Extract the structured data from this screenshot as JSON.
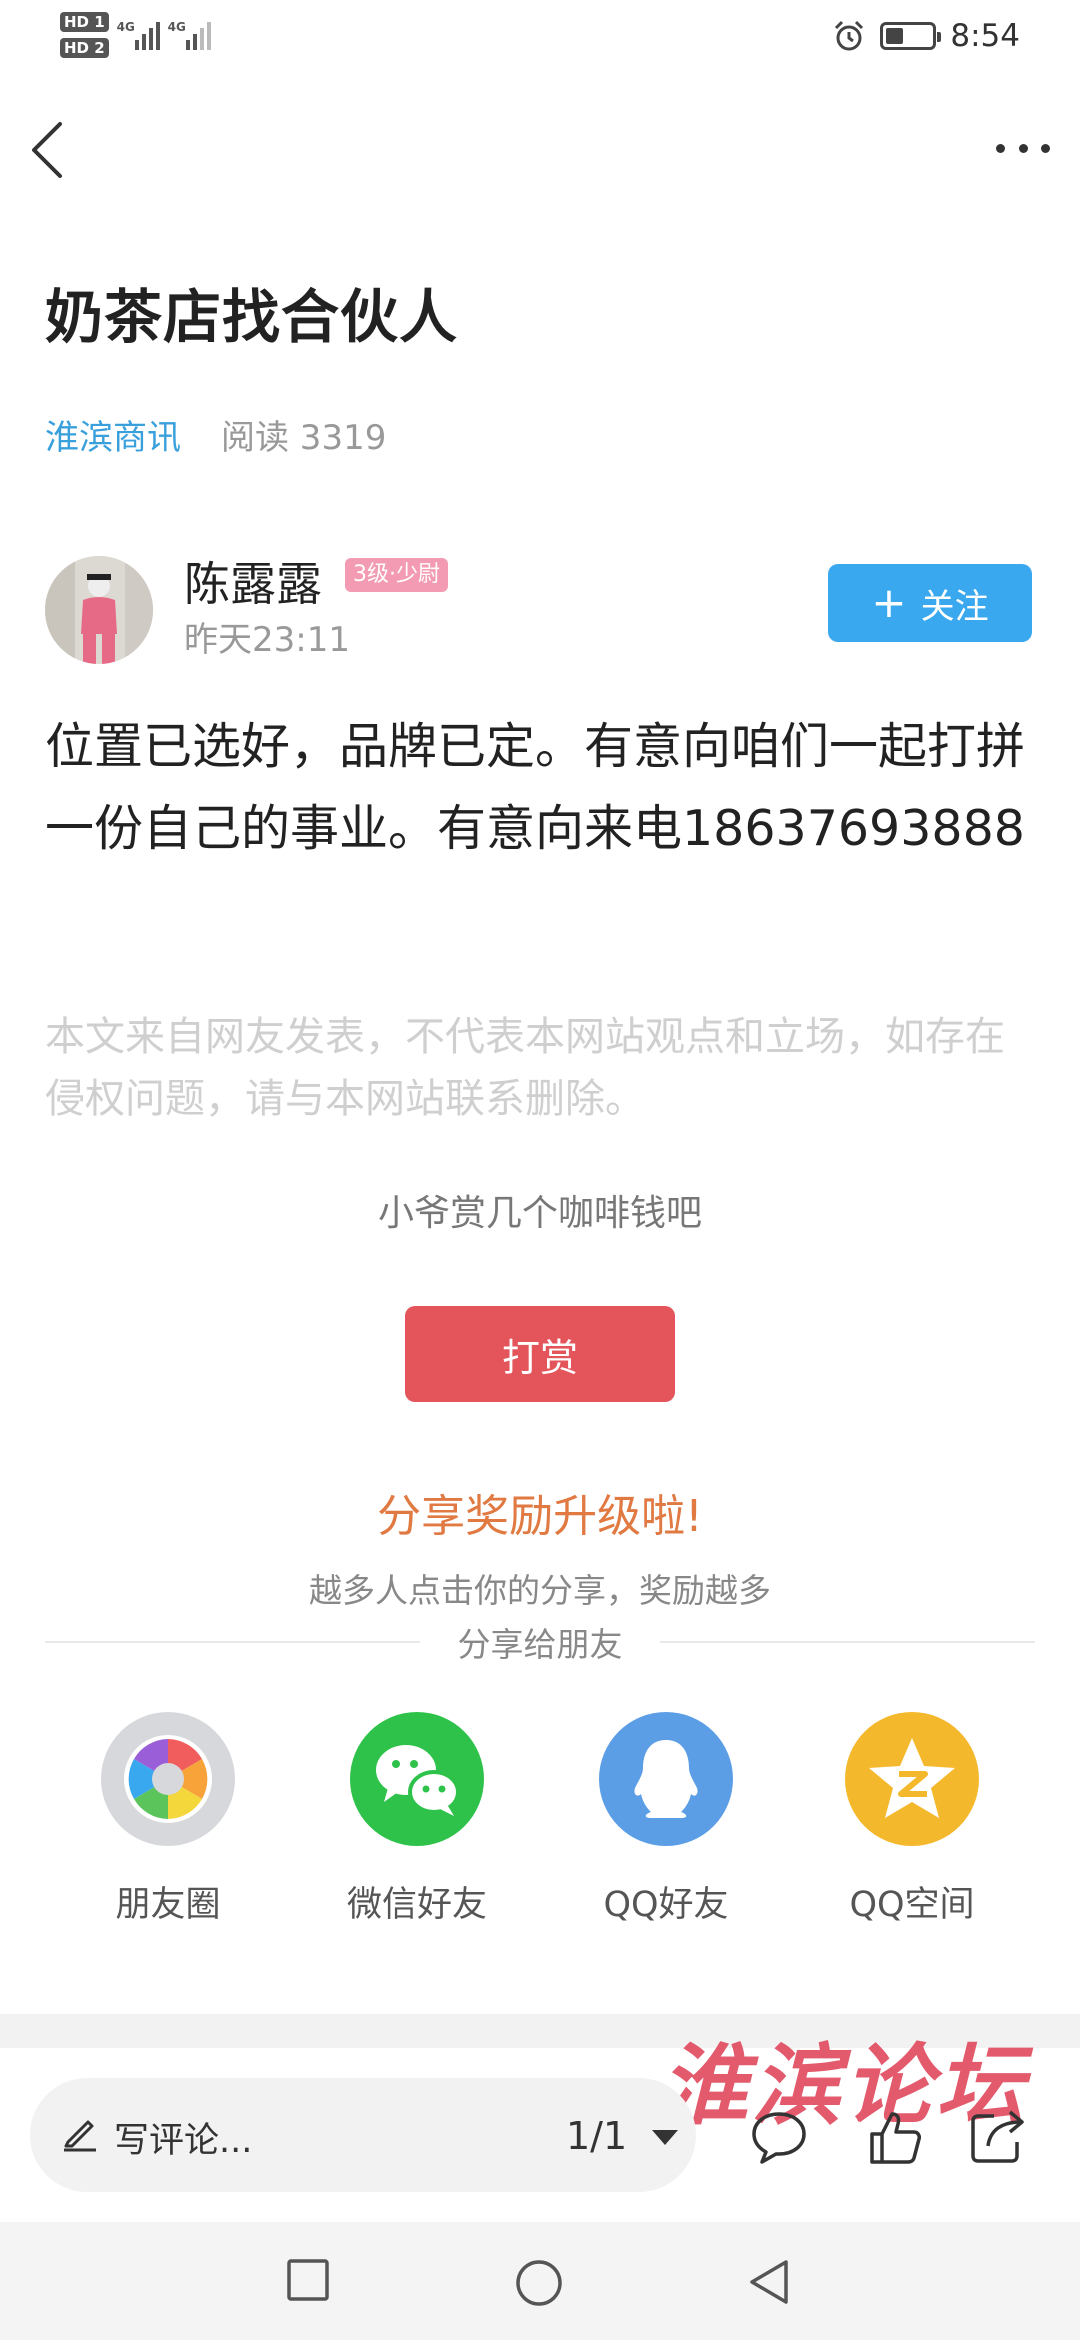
{
  "status_bar": {
    "sim1": "HD 1",
    "sim2": "HD 2",
    "network1": "4G",
    "network2": "4G",
    "time": "8:54",
    "battery_level": 0.45,
    "icons": [
      "alarm-icon",
      "battery-icon"
    ]
  },
  "nav": {
    "back_icon": "chevron-left-icon",
    "more_icon": "more-dots-icon"
  },
  "article": {
    "title": "奶茶店找合伙人",
    "category": "淮滨商讯",
    "reads": "阅读 3319",
    "author": {
      "name": "陈露露",
      "level": "3级·少尉",
      "time": "昨天23:11"
    },
    "follow_label": "关注",
    "body": "位置已选好，品牌已定。有意向咱们一起打拼一份自己的事业。有意向来电18637693888",
    "disclaimer": "本文来自网友发表，不代表本网站观点和立场，如存在侵权问题，请与本网站联系删除。"
  },
  "reward": {
    "tip": "小爷赏几个咖啡钱吧",
    "button_label": "打赏"
  },
  "share": {
    "title": "分享奖励升级啦!",
    "subtitle": "越多人点击你的分享，奖励越多",
    "label": "分享给朋友",
    "targets": [
      {
        "label": "朋友圈",
        "icon": "moments-icon",
        "color": "#d6d8db"
      },
      {
        "label": "微信好友",
        "icon": "wechat-icon",
        "color": "#2ec24b"
      },
      {
        "label": "QQ好友",
        "icon": "qq-icon",
        "color": "#5b9ee6"
      },
      {
        "label": "QQ空间",
        "icon": "qzone-icon",
        "color": "#f4b82d"
      }
    ]
  },
  "bottom_bar": {
    "comment_placeholder": "写评论...",
    "pager": "1/1",
    "icons": [
      "comment-icon",
      "like-icon",
      "share-icon"
    ]
  },
  "watermark": "淮滨论坛",
  "colors": {
    "accent_blue": "#3aa8ee",
    "category_blue": "#3aa0dc",
    "reward_red": "#e3545b",
    "share_orange": "#e07a42"
  }
}
